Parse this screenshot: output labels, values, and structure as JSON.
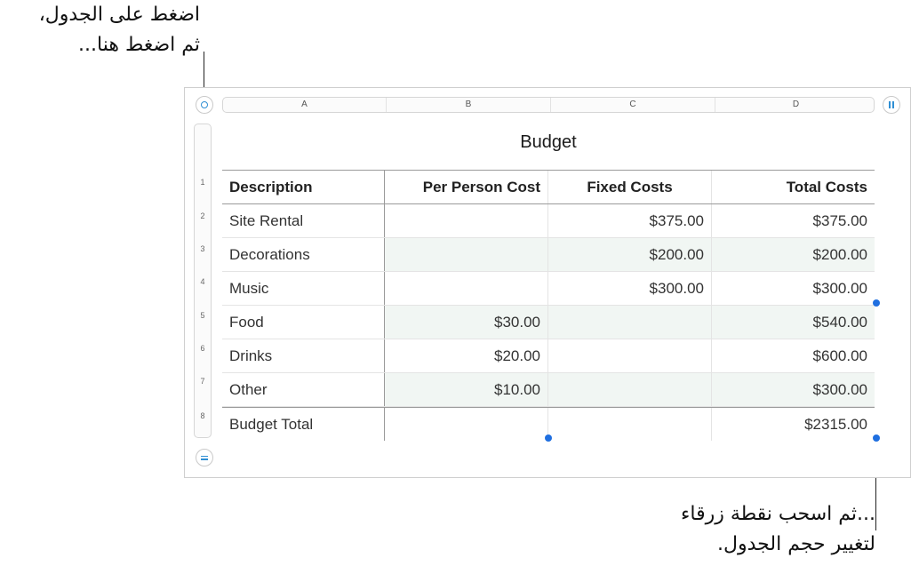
{
  "callouts": {
    "top_line1": "اضغط على الجدول،",
    "top_line2": "ثم اضغط هنا...",
    "bottom_line1": "...ثم اسحب نقطة زرقاء",
    "bottom_line2": "لتغيير حجم الجدول."
  },
  "icons": {
    "select_table": "circle-icon",
    "freeze_columns": "pause-bars-icon",
    "add_rows": "equals-icon"
  },
  "columns": [
    "A",
    "B",
    "C",
    "D"
  ],
  "row_numbers": [
    "1",
    "2",
    "3",
    "4",
    "5",
    "6",
    "7",
    "8"
  ],
  "table": {
    "title": "Budget",
    "headers": [
      "Description",
      "Per Person Cost",
      "Fixed Costs",
      "Total Costs"
    ],
    "rows": [
      [
        "Site Rental",
        "",
        "$375.00",
        "$375.00"
      ],
      [
        "Decorations",
        "",
        "$200.00",
        "$200.00"
      ],
      [
        "Music",
        "",
        "$300.00",
        "$300.00"
      ],
      [
        "Food",
        "$30.00",
        "",
        "$540.00"
      ],
      [
        "Drinks",
        "$20.00",
        "",
        "$600.00"
      ],
      [
        "Other",
        "$10.00",
        "",
        "$300.00"
      ]
    ],
    "footer": [
      "Budget Total",
      "",
      "",
      "$2315.00"
    ]
  },
  "colors": {
    "handle": "#1f6fe0",
    "accent": "#2f8fd4",
    "shade": "#f1f6f3"
  }
}
